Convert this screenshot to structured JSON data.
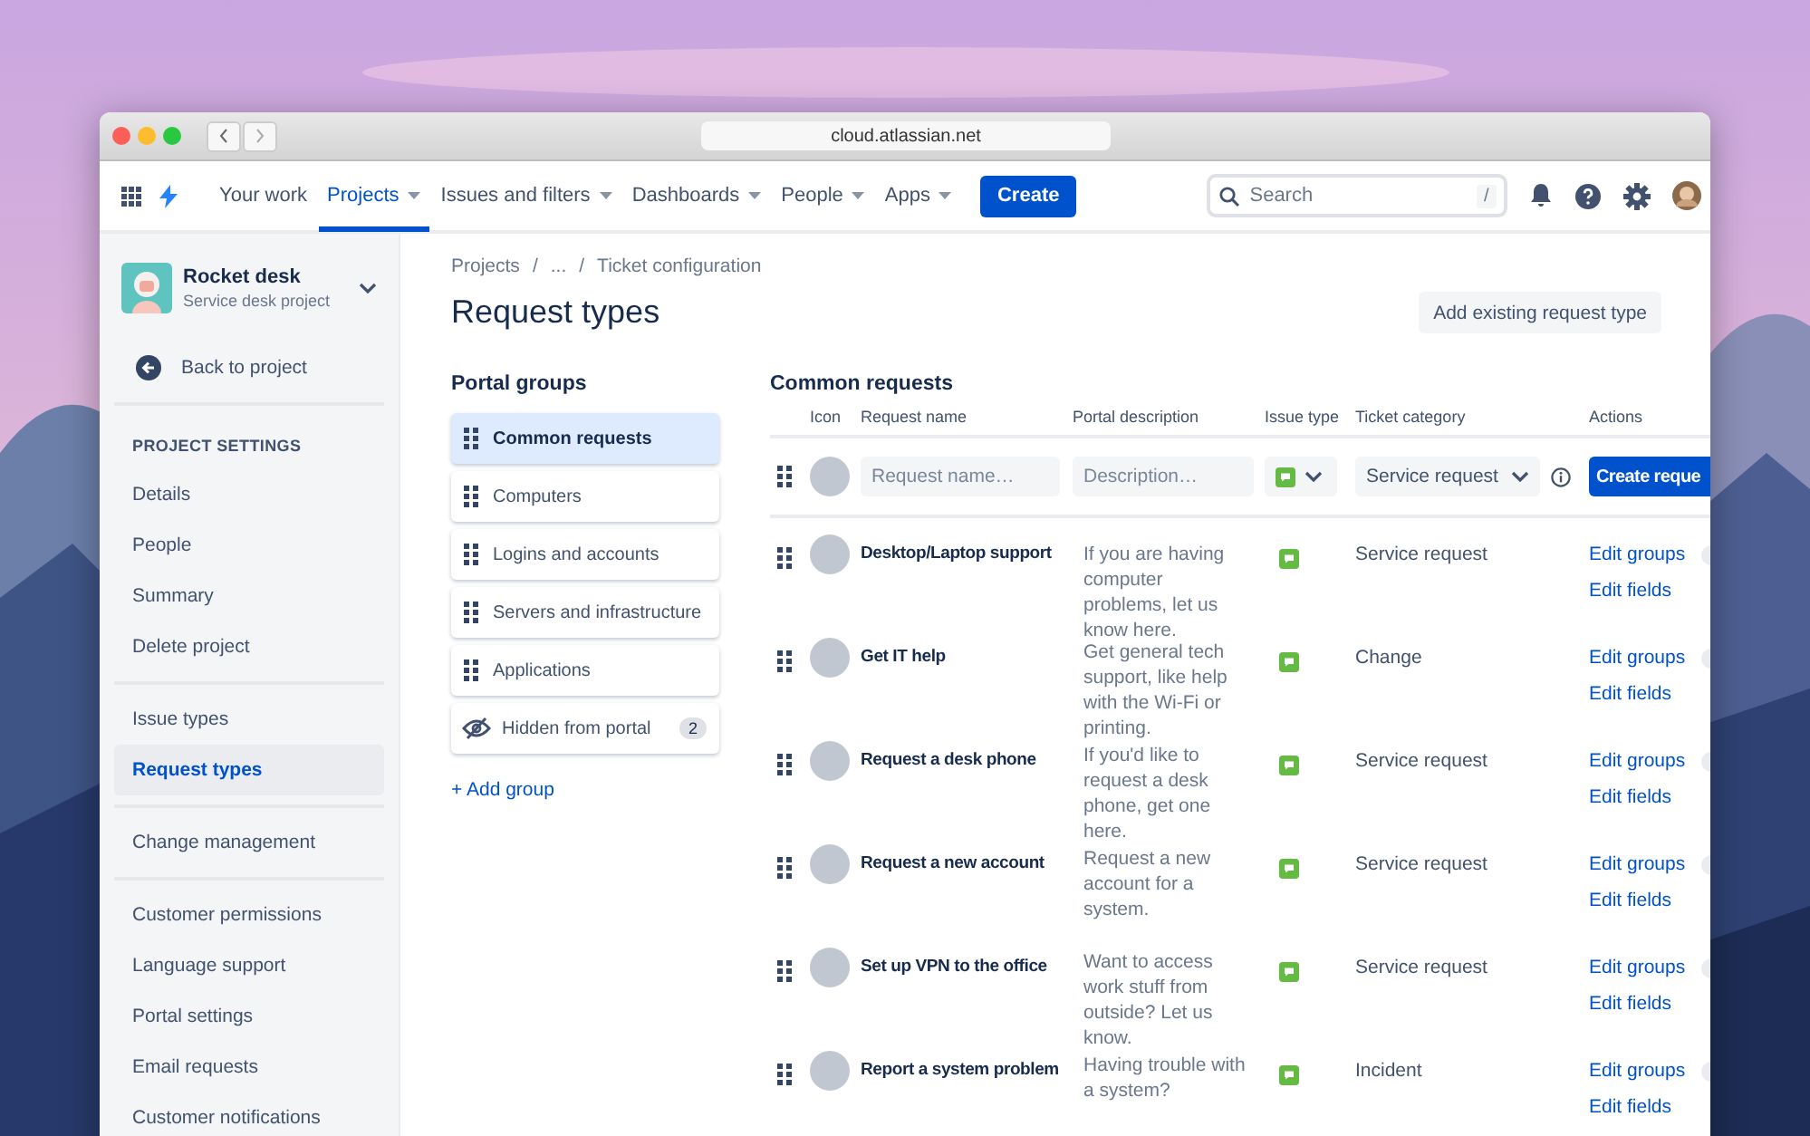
{
  "browser": {
    "url": "cloud.atlassian.net"
  },
  "nav": {
    "items": [
      {
        "label": "Your work",
        "dropdown": false,
        "selected": false
      },
      {
        "label": "Projects",
        "dropdown": true,
        "selected": true
      },
      {
        "label": "Issues and filters",
        "dropdown": true,
        "selected": false
      },
      {
        "label": "Dashboards",
        "dropdown": true,
        "selected": false
      },
      {
        "label": "People",
        "dropdown": true,
        "selected": false
      },
      {
        "label": "Apps",
        "dropdown": true,
        "selected": false
      }
    ],
    "create": "Create",
    "search": {
      "placeholder": "Search",
      "shortcut": "/"
    }
  },
  "sidebar": {
    "project": {
      "name": "Rocket desk",
      "type": "Service desk project"
    },
    "back": "Back to project",
    "heading": "PROJECT SETTINGS",
    "sections": [
      {
        "items": [
          {
            "label": "Details",
            "selected": false
          },
          {
            "label": "People",
            "selected": false
          },
          {
            "label": "Summary",
            "selected": false
          },
          {
            "label": "Delete project",
            "selected": false
          }
        ]
      },
      {
        "items": [
          {
            "label": "Issue types",
            "selected": false
          },
          {
            "label": "Request types",
            "selected": true
          }
        ]
      },
      {
        "items": [
          {
            "label": "Change management",
            "selected": false
          }
        ]
      },
      {
        "items": [
          {
            "label": "Customer permissions",
            "selected": false
          },
          {
            "label": "Language support",
            "selected": false
          },
          {
            "label": "Portal settings",
            "selected": false
          },
          {
            "label": "Email requests",
            "selected": false
          },
          {
            "label": "Customer notifications",
            "selected": false
          }
        ]
      }
    ]
  },
  "breadcrumbs": {
    "separator": "/",
    "items": [
      "Projects",
      "...",
      "Ticket configuration"
    ]
  },
  "title": "Request types",
  "add_button": "Add existing request type",
  "portal_groups": {
    "title": "Portal groups",
    "add": "+ Add group",
    "groups": [
      {
        "label": "Common requests",
        "kind": "group",
        "selected": true
      },
      {
        "label": "Computers",
        "kind": "group",
        "selected": false
      },
      {
        "label": "Logins and accounts",
        "kind": "group",
        "selected": false
      },
      {
        "label": "Servers and infrastructure",
        "kind": "group",
        "selected": false
      },
      {
        "label": "Applications",
        "kind": "group",
        "selected": false
      },
      {
        "label": "Hidden from portal",
        "kind": "hidden",
        "selected": false,
        "count": "2"
      }
    ]
  },
  "table": {
    "title": "Common requests",
    "columns": [
      "Icon",
      "Request name",
      "Portal description",
      "Issue type",
      "Ticket category",
      "Actions"
    ],
    "new_row": {
      "name_placeholder": "Request name…",
      "description_placeholder": "Description…",
      "category": "Service request",
      "button": "Create reque"
    },
    "rows": [
      {
        "name": "Desktop/Laptop support",
        "description": "If you are having computer problems, let us know here.",
        "category": "Service request",
        "actions": [
          "Edit groups",
          "Edit fields"
        ]
      },
      {
        "name": "Get IT help",
        "description": "Get general tech support, like help with the Wi-Fi or printing.",
        "category": "Change",
        "actions": [
          "Edit groups",
          "Edit fields"
        ]
      },
      {
        "name": "Request a desk phone",
        "description": "If you'd like to request a desk phone, get one here.",
        "category": "Service request",
        "actions": [
          "Edit groups",
          "Edit fields"
        ]
      },
      {
        "name": "Request a new account",
        "description": "Request a new account for a system.",
        "category": "Service request",
        "actions": [
          "Edit groups",
          "Edit fields"
        ]
      },
      {
        "name": "Set up VPN to the office",
        "description": "Want to access work stuff from outside? Let us know.",
        "category": "Service request",
        "actions": [
          "Edit groups",
          "Edit fields"
        ]
      },
      {
        "name": "Report a system problem",
        "description": "Having trouble with a system?",
        "category": "Incident",
        "actions": [
          "Edit groups",
          "Edit fields"
        ]
      }
    ]
  }
}
